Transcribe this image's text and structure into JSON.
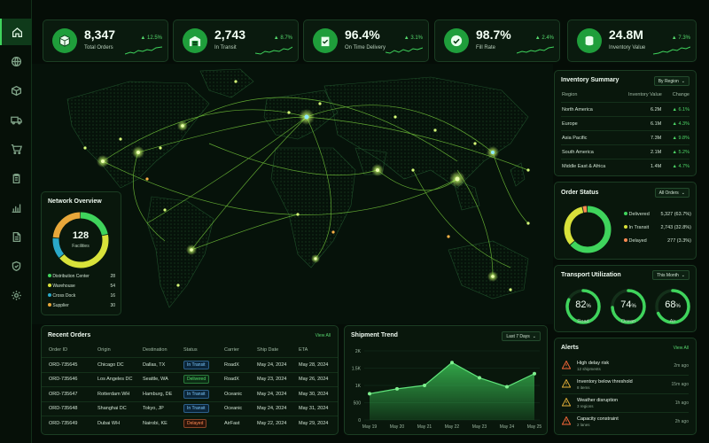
{
  "colors": {
    "accent": "#3fd45c",
    "background": "#050d07",
    "panel": "#09170c",
    "transit": "#7ec9ff",
    "delayed": "#ff8b52",
    "yellow": "#d9e23a"
  },
  "sidebar": {
    "items": [
      {
        "icon": "home-icon",
        "active": true
      },
      {
        "icon": "globe-icon"
      },
      {
        "icon": "box-icon"
      },
      {
        "icon": "truck-icon"
      },
      {
        "icon": "cart-icon"
      },
      {
        "icon": "clipboard-icon"
      },
      {
        "icon": "bar-chart-icon"
      },
      {
        "icon": "document-icon"
      },
      {
        "icon": "shield-icon"
      },
      {
        "icon": "gear-icon"
      }
    ]
  },
  "kpis": [
    {
      "value": "8,347",
      "label": "Total Orders",
      "change": "▲ 12.5%",
      "icon": "cube-icon"
    },
    {
      "value": "2,743",
      "label": "In Transit",
      "change": "▲ 8.7%",
      "icon": "warehouse-icon"
    },
    {
      "value": "96.4%",
      "label": "On Time Delivery",
      "change": "▲ 3.1%",
      "icon": "clipboard-check-icon"
    },
    {
      "value": "98.7%",
      "label": "Fill Rate",
      "change": "▲ 2.4%",
      "icon": "check-circle-icon"
    },
    {
      "value": "24.8M",
      "label": "Inventory Value",
      "change": "▲ 7.3%",
      "icon": "coins-icon"
    }
  ],
  "network": {
    "title": "Network Overview",
    "total": "128",
    "total_label": "Facilities",
    "items": [
      {
        "label": "Distribution Center",
        "value": 28,
        "color": "#3fd45c"
      },
      {
        "label": "Warehouse",
        "value": 54,
        "color": "#d9e23a"
      },
      {
        "label": "Cross Dock",
        "value": 16,
        "color": "#2aa8c9"
      },
      {
        "label": "Supplier",
        "value": 30,
        "color": "#e8a73a"
      }
    ]
  },
  "inventory": {
    "title": "Inventory Summary",
    "select": "By Region",
    "headers": [
      "Region",
      "Inventory Value",
      "Change"
    ],
    "rows": [
      {
        "region": "North America",
        "value": "6.2M",
        "change": "▲ 6.1%"
      },
      {
        "region": "Europe",
        "value": "6.1M",
        "change": "▲ 4.3%"
      },
      {
        "region": "Asia Pacific",
        "value": "7.3M",
        "change": "▲ 9.8%"
      },
      {
        "region": "South America",
        "value": "2.1M",
        "change": "▲ 5.2%"
      },
      {
        "region": "Middle East & Africa",
        "value": "1.4M",
        "change": "▲ 4.7%"
      }
    ]
  },
  "order_status": {
    "title": "Order Status",
    "select": "All Orders",
    "items": [
      {
        "label": "Delivered",
        "value": "5,327 (63.7%)",
        "fraction": 0.637,
        "color": "#3fd45c"
      },
      {
        "label": "In Transit",
        "value": "2,743 (32.8%)",
        "fraction": 0.328,
        "color": "#d9e23a"
      },
      {
        "label": "Delayed",
        "value": "277 (3.3%)",
        "fraction": 0.033,
        "color": "#ff8b52"
      }
    ]
  },
  "transport": {
    "title": "Transport Utilization",
    "select": "This Month",
    "gauges": [
      {
        "label": "Road",
        "value": "82",
        "unit": "%",
        "fraction": 0.82,
        "color": "#3fd45c"
      },
      {
        "label": "Ocean",
        "value": "74",
        "unit": "%",
        "fraction": 0.74,
        "color": "#3fd45c"
      },
      {
        "label": "Air",
        "value": "68",
        "unit": "%",
        "fraction": 0.68,
        "color": "#3fd45c"
      }
    ]
  },
  "recent_orders": {
    "title": "Recent Orders",
    "link": "View All",
    "headers": [
      "Order ID",
      "Origin",
      "Destination",
      "Status",
      "Carrier",
      "Ship Date",
      "ETA"
    ],
    "rows": [
      {
        "id": "ORD-735645",
        "origin": "Chicago DC",
        "dest": "Dallas, TX",
        "status": "In Transit",
        "st": "transit",
        "carrier": "RoadX",
        "ship": "May 24, 2024",
        "eta": "May 28, 2024"
      },
      {
        "id": "ORD-735646",
        "origin": "Los Angeles DC",
        "dest": "Seattle, WA",
        "status": "Delivered",
        "st": "delivered",
        "carrier": "RoadX",
        "ship": "May 23, 2024",
        "eta": "May 26, 2024"
      },
      {
        "id": "ORD-735647",
        "origin": "Rotterdam WH",
        "dest": "Hamburg, DE",
        "status": "In Transit",
        "st": "transit",
        "carrier": "Oceanic",
        "ship": "May 24, 2024",
        "eta": "May 30, 2024"
      },
      {
        "id": "ORD-735648",
        "origin": "Shanghai DC",
        "dest": "Tokyo, JP",
        "status": "In Transit",
        "st": "transit",
        "carrier": "Oceanic",
        "ship": "May 24, 2024",
        "eta": "May 31, 2024"
      },
      {
        "id": "ORD-735649",
        "origin": "Dubai WH",
        "dest": "Nairobi, KE",
        "status": "Delayed",
        "st": "delayed",
        "carrier": "AirFast",
        "ship": "May 22, 2024",
        "eta": "May 29, 2024"
      }
    ]
  },
  "shipment_trend": {
    "title": "Shipment Trend",
    "select": "Last 7 Days"
  },
  "chart_data": {
    "type": "area",
    "title": "Shipment Trend",
    "categories": [
      "May 19",
      "May 20",
      "May 21",
      "May 22",
      "May 23",
      "May 24",
      "May 25"
    ],
    "values": [
      760,
      900,
      1000,
      1660,
      1220,
      960,
      1340
    ],
    "y_ticks": [
      "0",
      "500",
      "1K",
      "1.5K",
      "2K"
    ],
    "ylim": [
      0,
      2000
    ],
    "grid": true
  },
  "alerts": {
    "title": "Alerts",
    "link": "View All",
    "items": [
      {
        "title": "High delay risk",
        "sub": "12 shipments",
        "time": "2m ago",
        "color": "#ff6a3a"
      },
      {
        "title": "Inventory below threshold",
        "sub": "8 items",
        "time": "15m ago",
        "color": "#e8b33a"
      },
      {
        "title": "Weather disruption",
        "sub": "3 regions",
        "time": "1h ago",
        "color": "#e8b33a"
      },
      {
        "title": "Capacity constraint",
        "sub": "2 lanes",
        "time": "2h ago",
        "color": "#ff6a3a"
      }
    ]
  }
}
